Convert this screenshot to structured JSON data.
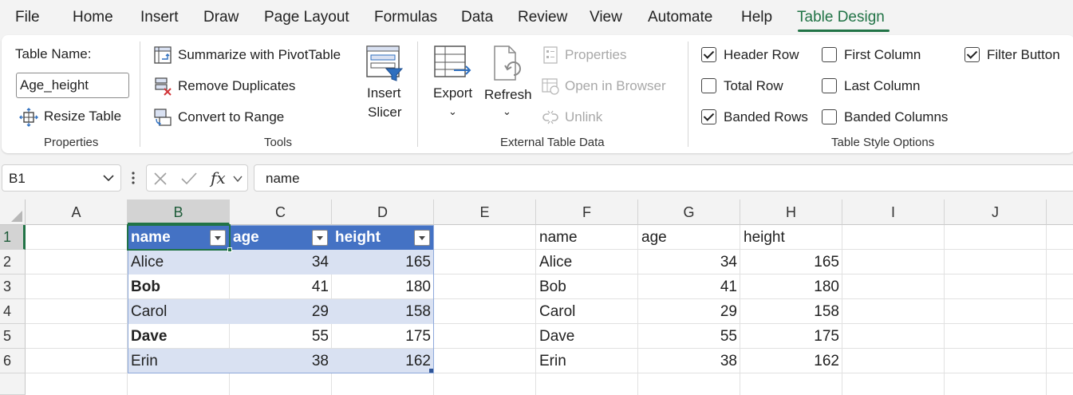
{
  "menu": {
    "tabs": [
      "File",
      "Home",
      "Insert",
      "Draw",
      "Page Layout",
      "Formulas",
      "Data",
      "Review",
      "View",
      "Automate",
      "Help",
      "Table Design"
    ],
    "active": "Table Design"
  },
  "ribbon": {
    "properties": {
      "table_name_label": "Table Name:",
      "table_name_value": "Age_height",
      "resize_label": "Resize Table",
      "group_label": "Properties"
    },
    "tools": {
      "pivot_label": "Summarize with PivotTable",
      "remove_dup_label": "Remove Duplicates",
      "convert_label": "Convert to Range",
      "insert_slicer_line1": "Insert",
      "insert_slicer_line2": "Slicer",
      "group_label": "Tools"
    },
    "external": {
      "export_label": "Export",
      "refresh_label": "Refresh",
      "properties_label": "Properties",
      "open_browser_label": "Open in Browser",
      "unlink_label": "Unlink",
      "group_label": "External Table Data"
    },
    "style_options": {
      "header_row": {
        "label": "Header Row",
        "checked": true
      },
      "total_row": {
        "label": "Total Row",
        "checked": false
      },
      "banded_rows": {
        "label": "Banded Rows",
        "checked": true
      },
      "first_column": {
        "label": "First Column",
        "checked": false
      },
      "last_column": {
        "label": "Last Column",
        "checked": false
      },
      "banded_columns": {
        "label": "Banded Columns",
        "checked": false
      },
      "filter_button": {
        "label": "Filter Button",
        "checked": true
      },
      "group_label": "Table Style Options"
    }
  },
  "formula_bar": {
    "name_box": "B1",
    "fx_label": "fx",
    "formula": "name"
  },
  "sheet": {
    "columns": [
      "A",
      "B",
      "C",
      "D",
      "E",
      "F",
      "G",
      "H",
      "I",
      "J"
    ],
    "rows": [
      "1",
      "2",
      "3",
      "4",
      "5",
      "6"
    ],
    "table": {
      "headers": [
        "name",
        "age",
        "height"
      ],
      "rows": [
        [
          "Alice",
          "34",
          "165"
        ],
        [
          "Bob",
          "41",
          "180"
        ],
        [
          "Carol",
          "29",
          "158"
        ],
        [
          "Dave",
          "55",
          "175"
        ],
        [
          "Erin",
          "38",
          "162"
        ]
      ]
    },
    "plain": {
      "headers": [
        "name",
        "age",
        "height"
      ],
      "rows": [
        [
          "Alice",
          "34",
          "165"
        ],
        [
          "Bob",
          "41",
          "180"
        ],
        [
          "Carol",
          "29",
          "158"
        ],
        [
          "Dave",
          "55",
          "175"
        ],
        [
          "Erin",
          "38",
          "162"
        ]
      ]
    },
    "colors": {
      "table_header": "#4472c4",
      "band": "#d9e1f2",
      "accent": "#217346"
    }
  }
}
